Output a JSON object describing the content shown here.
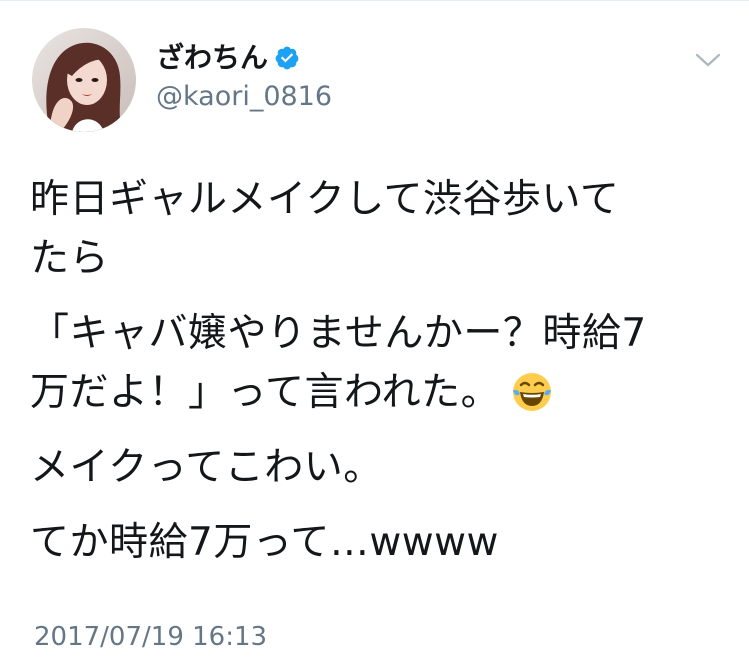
{
  "author": {
    "display_name": "ざわちん",
    "handle": "@kaori_0816",
    "verified": true
  },
  "tweet": {
    "lines": [
      [
        "昨日ギャルメイクして渋谷歩いて",
        "たら"
      ],
      [
        "「キャバ嬢やりませんかー？時給7",
        "万だよ！」って言われた。"
      ],
      [
        "メイクってこわい。"
      ],
      [
        "てか時給7万って…wwww"
      ]
    ],
    "emoji": "face-with-tears-of-joy-icon"
  },
  "timestamp": "2017/07/19 16:13",
  "icons": {
    "verified": "verified-badge-icon",
    "menu": "chevron-down-icon",
    "avatar": "avatar"
  },
  "colors": {
    "text": "#14171a",
    "muted": "#657786",
    "verified": "#1da1f2",
    "background": "#ffffff"
  }
}
